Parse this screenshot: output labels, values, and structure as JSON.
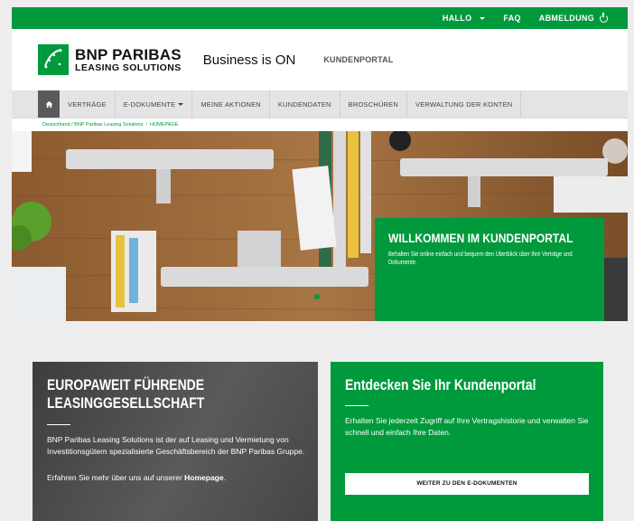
{
  "topbar": {
    "hallo": "HALLO",
    "faq": "FAQ",
    "logout": "ABMELDUNG"
  },
  "header": {
    "logo_line1": "BNP PARIBAS",
    "logo_line2": "LEASING SOLUTIONS",
    "tagline": "Business is ON",
    "portal": "KUNDENPORTAL"
  },
  "nav": {
    "items": [
      {
        "label": "VERTRÄGE"
      },
      {
        "label": "E-DOKUMENTE"
      },
      {
        "label": "MEINE AKTIONEN"
      },
      {
        "label": "KUNDENDATEN"
      },
      {
        "label": "BROSCHÜREN"
      },
      {
        "label": "VERWALTUNG DER KONTEN"
      }
    ]
  },
  "breadcrumb": {
    "part1": "Deutschland / BNP Paribas Leasing Solutions",
    "sep": "/",
    "current": "HOMEPAGE"
  },
  "hero": {
    "title": "WILLKOMMEN IM KUNDENPORTAL",
    "subtitle": "Behalten Sie online einfach und bequem den Überblick über Ihre Verträge und Dokumente."
  },
  "card_left": {
    "title_l1": "EUROPAWEIT FÜHRENDE",
    "title_l2": "LEASINGGESELLSCHAFT",
    "text": "BNP Paribas Leasing Solutions ist der auf Leasing und Vermietung von Investitionsgütern spezialisierte Geschäftsbereich der BNP Paribas Gruppe.",
    "more_prefix": "Erfahren Sie mehr über uns auf unserer ",
    "more_link": "Homepage",
    "more_suffix": "."
  },
  "card_right": {
    "title": "Entdecken Sie Ihr Kundenportal",
    "text": "Erhalten Sie jederzeit Zugriff auf Ihre Vertragshistorie und verwalten Sie schnell und einfach Ihre Daten.",
    "button": "WEITER ZU DEN E-DOKUMENTEN"
  },
  "colors": {
    "brand_green": "#009a3c",
    "nav_bg": "#e4e4e4",
    "dark_card": "#4a4a4a"
  }
}
